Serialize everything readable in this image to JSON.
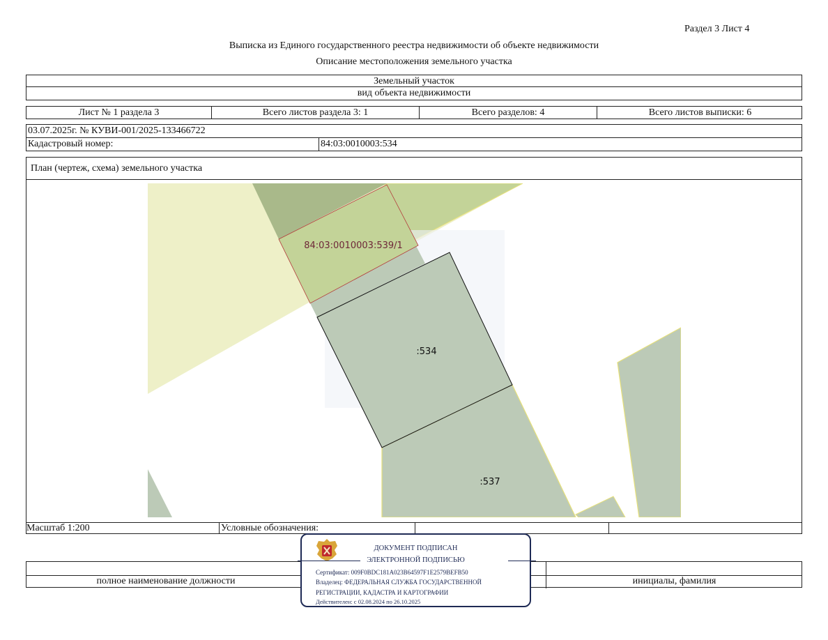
{
  "header": {
    "section_sheet": "Раздел 3   Лист 4",
    "title": "Выписка из Единого государственного реестра недвижимости об объекте недвижимости",
    "subtitle": "Описание местоположения земельного участка"
  },
  "object": {
    "type": "Земельный участок",
    "type_caption": "вид объекта недвижимости"
  },
  "sheets": {
    "sheet_no": "Лист № 1 раздела 3",
    "total_section_sheets": "Всего листов раздела 3: 1",
    "total_sections": "Всего разделов: 4",
    "total_extract_sheets": "Всего листов выписки: 6"
  },
  "record": {
    "date_number": "03.07.2025г. № КУВИ-001/2025-133466722",
    "cadastral_label": "Кадастровый номер:",
    "cadastral_value": "84:03:0010003:534"
  },
  "plan": {
    "title": "План (чертеж, схема) земельного участка",
    "labels": {
      "parcel_539_1": "84:03:0010003:539/1",
      "parcel_534": ":534",
      "parcel_537": ":537"
    },
    "colors": {
      "light_zone": "#eef0c8",
      "green_zone": "#c3d398",
      "dark_zone": "#a9b98a",
      "parcel_fill": "#bccab7",
      "overlay": "#eef2f6",
      "red_border": "#b33a3a",
      "yellow_border": "#e6e07a"
    }
  },
  "legend": {
    "scale": "Масштаб 1:200",
    "symbols": "Условные обозначения:"
  },
  "stamp": {
    "line1": "ДОКУМЕНТ ПОДПИСАН",
    "line2": "ЭЛЕКТРОННОЙ ПОДПИСЬЮ",
    "certificate": "Сертификат: 009F0BDC181A023B64597F1E2579BEFB50",
    "owner1": "Владелец: ФЕДЕРАЛЬНАЯ СЛУЖБА ГОСУДАРСТВЕННОЙ",
    "owner2": "РЕГИСТРАЦИИ, КАДАСТРА И КАРТОГРАФИИ",
    "validity": "Действителен: с 02.08.2024 по 26.10.2025",
    "emblem_icon": "coat-of-arms-icon"
  },
  "signature": {
    "position_caption": "полное наименование должности",
    "name_caption": "инициалы, фамилия"
  }
}
